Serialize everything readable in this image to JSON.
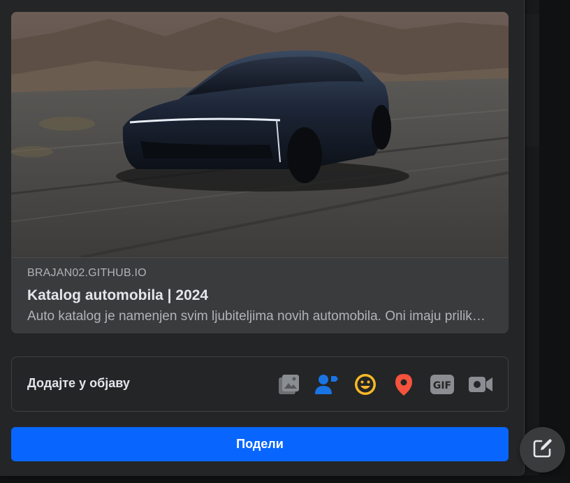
{
  "link_preview": {
    "domain": "BRAJAN02.GITHUB.IO",
    "title": "Katalog automobila | 2024",
    "description": "Auto katalog je namenjen svim ljubiteljima novih automobila. Oni imaju priliku da pronađu informacije o automobilima."
  },
  "add_to_post": {
    "label": "Додајте у објаву",
    "icons": [
      "photo-video-icon",
      "tag-people-icon",
      "feeling-icon",
      "check-in-icon",
      "gif-icon",
      "live-video-icon"
    ]
  },
  "share_button": {
    "label": "Подели"
  },
  "colors": {
    "accent": "#0866ff",
    "tag_people": "#1b74e4",
    "feeling": "#f7b928",
    "check_in": "#f5533d",
    "muted_icon": "#8a8d91"
  }
}
